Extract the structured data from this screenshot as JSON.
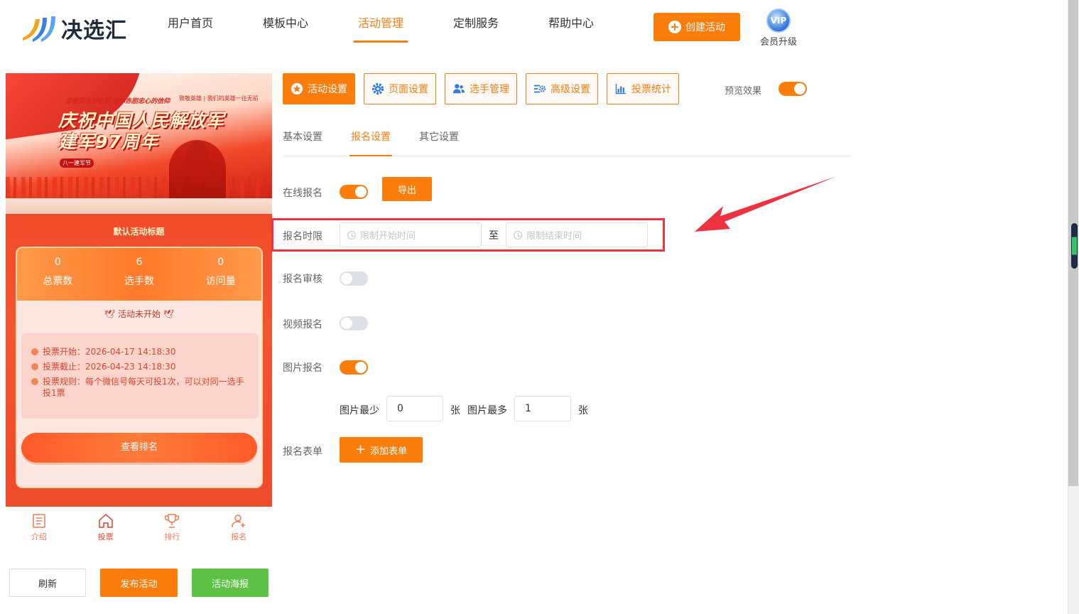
{
  "brand": {
    "name": "决选汇"
  },
  "nav": [
    {
      "label": "用户首页"
    },
    {
      "label": "模板中心"
    },
    {
      "label": "活动管理",
      "active": true
    },
    {
      "label": "定制服务"
    },
    {
      "label": "帮助中心"
    }
  ],
  "header": {
    "create_label": "创建活动",
    "vip_badge": "VIP",
    "vip_label": "会员升级"
  },
  "preview": {
    "banner_tagline": "身披荣光的铁军 是你赤胆忠心的信仰",
    "banner_tagline2": "致敬英雄 | 我们的英雄一往无前",
    "banner_title_line1": "庆祝中国人民解放军",
    "banner_title_line2": "建军97周年",
    "banner_tag": "八一建军节",
    "activity_title": "默认活动标题",
    "stats": [
      {
        "value": "0",
        "label": "总票数"
      },
      {
        "value": "6",
        "label": "选手数"
      },
      {
        "value": "0",
        "label": "访问量"
      }
    ],
    "status": "活动未开始",
    "info": [
      {
        "text": "投票开始：2026-04-17 14:18:30"
      },
      {
        "text": "投票截止：2026-04-23 14:18:30"
      },
      {
        "text": "投票规则：每个微信号每天可投1次，可以对同一选手投1票"
      }
    ],
    "rank_button": "查看排名",
    "tabs": [
      {
        "label": "介绍",
        "icon": "list-icon"
      },
      {
        "label": "投票",
        "icon": "home-icon",
        "active": true
      },
      {
        "label": "排行",
        "icon": "trophy-icon"
      },
      {
        "label": "报名",
        "icon": "user-add-icon"
      }
    ]
  },
  "actions": {
    "refresh": "刷新",
    "publish": "发布活动",
    "poster": "活动海报"
  },
  "toolbar": [
    {
      "label": "活动设置",
      "icon": "star-circle-icon",
      "active": true
    },
    {
      "label": "页面设置",
      "icon": "gear-icon"
    },
    {
      "label": "选手管理",
      "icon": "users-icon"
    },
    {
      "label": "高级设置",
      "icon": "sliders-icon"
    },
    {
      "label": "投票统计",
      "icon": "bar-chart-icon"
    }
  ],
  "preview_toggle": {
    "label": "预览效果",
    "on": true
  },
  "subtabs": [
    {
      "label": "基本设置"
    },
    {
      "label": "报名设置",
      "active": true
    },
    {
      "label": "其它设置"
    }
  ],
  "form": {
    "online_signup": {
      "label": "在线报名",
      "on": true,
      "export_label": "导出"
    },
    "signup_period": {
      "label": "报名时限",
      "start_placeholder": "限制开始时间",
      "end_placeholder": "限制结束时间",
      "to_text": "至"
    },
    "signup_review": {
      "label": "报名审核",
      "on": false
    },
    "video_signup": {
      "label": "视频报名",
      "on": false
    },
    "image_signup": {
      "label": "图片报名",
      "on": true
    },
    "image_limits": {
      "min_label": "图片最少",
      "min_value": "0",
      "unit": "张",
      "max_label": "图片最多",
      "max_value": "1"
    },
    "signup_form": {
      "label": "报名表单",
      "add_label": "添加表单"
    }
  },
  "colors": {
    "accent": "#fb7d0c",
    "success": "#5cc144",
    "highlight": "#ee3340"
  }
}
